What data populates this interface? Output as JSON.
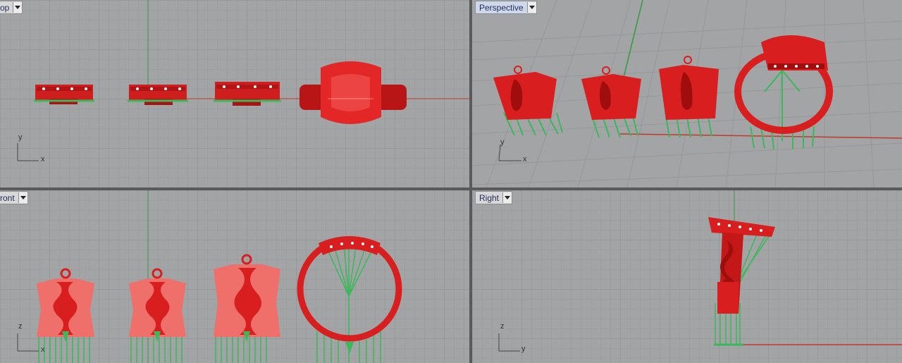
{
  "viewports": [
    {
      "title": "Top",
      "shown_label": "op",
      "axes": [
        "y",
        "x"
      ],
      "active": false
    },
    {
      "title": "Perspective",
      "shown_label": "Perspective",
      "axes": [
        "y",
        "x"
      ],
      "active": true
    },
    {
      "title": "Front",
      "shown_label": "ront",
      "axes": [
        "z",
        "x"
      ],
      "active": false
    },
    {
      "title": "Right",
      "shown_label": "Right",
      "axes": [
        "z",
        "y"
      ],
      "active": false
    }
  ],
  "colors": {
    "viewport_bg": "#a3a4a6",
    "grid_minor": "#999a9c",
    "grid_major": "#8c8d90",
    "object_red": "#d81e1e",
    "object_red_light": "#f07a72",
    "support_green": "#3ab85a",
    "axis_x_red": "#c0392b",
    "axis_y_green": "#2e9d3e"
  },
  "icons": {
    "viewport_menu": "chevron-down-icon",
    "axis_widget": "axis-triad-icon"
  }
}
